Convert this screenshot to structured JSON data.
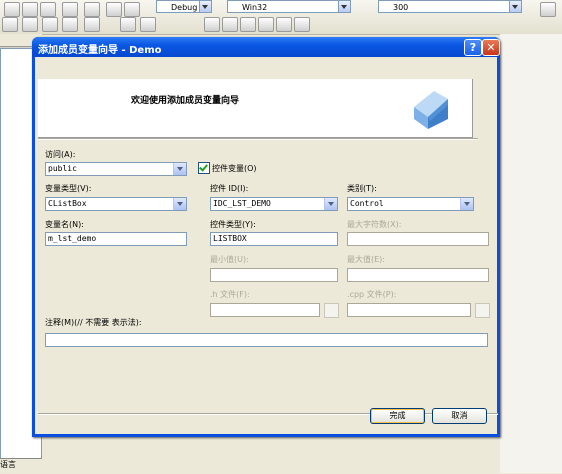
{
  "ide": {
    "config_value": "Debug",
    "platform_value": "Win32",
    "number_value": "300",
    "bottom_tab_label": "语言"
  },
  "dialog": {
    "title": "添加成员变量向导 - Demo",
    "header_text": "欢迎使用添加成员变量向导",
    "access_label": "访问(A):",
    "access_value": "public",
    "control_var_label": "控件变量(O)",
    "var_type_label": "变量类型(V):",
    "var_type_value": "CListBox",
    "control_id_label": "控件 ID(I):",
    "control_id_value": "IDC_LST_DEMO",
    "category_label": "类别(T):",
    "category_value": "Control",
    "var_name_label": "变量名(N):",
    "var_name_value": "m_lst_demo",
    "control_type_label": "控件类型(Y):",
    "control_type_value": "LISTBOX",
    "max_chars_label": "最大字符数(X):",
    "min_value_label": "最小值(U):",
    "max_value_label": "最大值(E):",
    "h_file_label": ".h 文件(F):",
    "cpp_file_label": ".cpp 文件(P):",
    "comment_label": "注释(M)(// 不需要 表示法):",
    "finish_label": "完成",
    "cancel_label": "取消",
    "help_glyph": "?",
    "close_glyph": "✕"
  },
  "colors": {
    "titlebar": "#0a58e3",
    "close_button": "#c8341b",
    "dialog_face": "#ece9d8"
  }
}
